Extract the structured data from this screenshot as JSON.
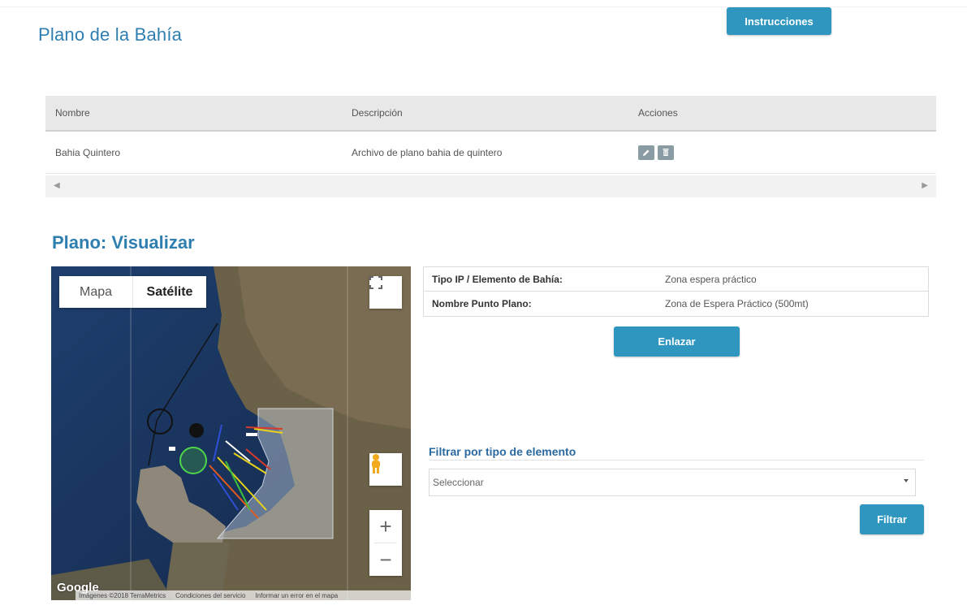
{
  "header": {
    "page_title": "Plano de la Bahía",
    "instrucciones_label": "Instrucciones"
  },
  "table": {
    "columns": [
      "Nombre",
      "Descripción",
      "Acciones"
    ],
    "rows": [
      {
        "nombre": "Bahia Quintero",
        "descripcion": "Archivo de plano bahia de quintero"
      }
    ],
    "actions": {
      "edit_icon": "pencil-icon",
      "delete_icon": "trash-icon",
      "color": "#8a9ba3"
    }
  },
  "viewer": {
    "section_title": "Plano: Visualizar",
    "map": {
      "map_type_options": [
        "Mapa",
        "Satélite"
      ],
      "selected_map_type": "Satélite",
      "zoom_in": "+",
      "zoom_out": "−",
      "logo": "Google",
      "attribution": [
        "Imágenes ©2018 TerraMetrics",
        "Condiciones del servicio",
        "Informar un error en el mapa"
      ]
    },
    "info": [
      {
        "label": "Tipo IP / Elemento de Bahía:",
        "value": "Zona espera práctico"
      },
      {
        "label": "Nombre Punto Plano:",
        "value": "Zona de Espera Práctico (500mt)"
      }
    ],
    "enlazar_label": "Enlazar"
  },
  "filter": {
    "title": "Filtrar por tipo de elemento",
    "select_value": "Seleccionar",
    "button_label": "Filtrar"
  },
  "colors": {
    "accent": "#2e96bf",
    "title": "#2e7fb0"
  }
}
